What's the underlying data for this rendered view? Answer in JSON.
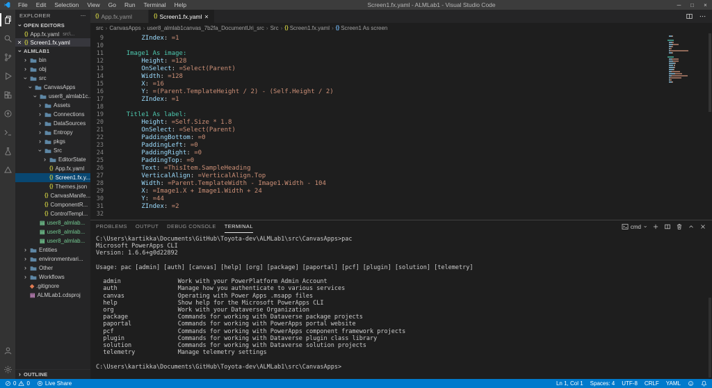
{
  "window": {
    "title": "Screen1.fx.yaml - ALMLab1 - Visual Studio Code",
    "menus": [
      "File",
      "Edit",
      "Selection",
      "View",
      "Go",
      "Run",
      "Terminal",
      "Help"
    ]
  },
  "activity_bar": {
    "top": [
      {
        "name": "explorer",
        "active": true
      },
      {
        "name": "search"
      },
      {
        "name": "source-control"
      },
      {
        "name": "run-debug"
      },
      {
        "name": "extensions"
      },
      {
        "name": "live-share"
      },
      {
        "name": "remote-explorer"
      },
      {
        "name": "test"
      },
      {
        "name": "power-platform"
      }
    ],
    "bottom": [
      {
        "name": "account"
      },
      {
        "name": "settings"
      }
    ]
  },
  "sidebar": {
    "title": "EXPLORER",
    "sections": {
      "open_editors": "OPEN EDITORS",
      "root": "ALMLAB1",
      "outline": "OUTLINE"
    },
    "open_editors": [
      {
        "label": "App.fx.yaml",
        "detail": "src\\...",
        "icon": "yaml",
        "active": false
      },
      {
        "label": "Screen1.fx.yaml",
        "icon": "yaml",
        "active": true
      }
    ],
    "tree": [
      {
        "label": "bin",
        "level": 1,
        "kind": "folder"
      },
      {
        "label": "obj",
        "level": 1,
        "kind": "folder"
      },
      {
        "label": "src",
        "level": 1,
        "kind": "folder",
        "expanded": true
      },
      {
        "label": "CanvasApps",
        "level": 2,
        "kind": "folder",
        "expanded": true
      },
      {
        "label": "user8_almlab1c...",
        "level": 3,
        "kind": "folder",
        "expanded": true
      },
      {
        "label": "Assets",
        "level": 4,
        "kind": "folder"
      },
      {
        "label": "Connections",
        "level": 4,
        "kind": "folder"
      },
      {
        "label": "DataSources",
        "level": 4,
        "kind": "folder"
      },
      {
        "label": "Entropy",
        "level": 4,
        "kind": "folder"
      },
      {
        "label": "pkgs",
        "level": 4,
        "kind": "folder"
      },
      {
        "label": "Src",
        "level": 4,
        "kind": "folder",
        "expanded": true
      },
      {
        "label": "EditorState",
        "level": 5,
        "kind": "folder"
      },
      {
        "label": "App.fx.yaml",
        "level": 5,
        "kind": "yaml"
      },
      {
        "label": "Screen1.fx.y...",
        "level": 5,
        "kind": "yaml",
        "selected": true
      },
      {
        "label": "Themes.json",
        "level": 5,
        "kind": "yaml"
      },
      {
        "label": "CanvasManife...",
        "level": 4,
        "kind": "yaml"
      },
      {
        "label": "ComponentR...",
        "level": 4,
        "kind": "yaml"
      },
      {
        "label": "ControlTempl...",
        "level": 4,
        "kind": "yaml"
      },
      {
        "label": "user8_almlab...",
        "level": 3,
        "kind": "file",
        "git": true
      },
      {
        "label": "user8_almlab...",
        "level": 3,
        "kind": "file",
        "git": true
      },
      {
        "label": "user8_almlab...",
        "level": 3,
        "kind": "file",
        "git": true
      },
      {
        "label": "Entities",
        "level": 1,
        "kind": "folder"
      },
      {
        "label": "environmentvari...",
        "level": 1,
        "kind": "folder"
      },
      {
        "label": "Other",
        "level": 1,
        "kind": "folder"
      },
      {
        "label": "Workflows",
        "level": 1,
        "kind": "folder"
      },
      {
        "label": ".gitignore",
        "level": 1,
        "kind": "git"
      },
      {
        "label": "ALMLab1.cdsproj",
        "level": 1,
        "kind": "proj"
      }
    ]
  },
  "editor": {
    "tabs": [
      {
        "label": "App.fx.yaml",
        "active": false
      },
      {
        "label": "Screen1.fx.yaml",
        "active": true
      }
    ],
    "breadcrumbs": [
      {
        "label": "src"
      },
      {
        "label": "CanvasApps"
      },
      {
        "label": "user8_almlab1canvas_7b2fa_DocumentUri_src"
      },
      {
        "label": "Src"
      },
      {
        "label": "Screen1.fx.yaml",
        "icon": "file"
      },
      {
        "label": "Screen1 As screen",
        "icon": "symbol"
      }
    ],
    "lines": [
      {
        "n": 9,
        "i": 8,
        "t": [
          [
            "ZIndex",
            "k"
          ],
          [
            ": ",
            "p"
          ],
          [
            "=1",
            "v"
          ]
        ]
      },
      {
        "n": 10,
        "i": 0,
        "t": []
      },
      {
        "n": 11,
        "i": 4,
        "t": [
          [
            "Image1 As image:",
            "d"
          ]
        ]
      },
      {
        "n": 12,
        "i": 8,
        "t": [
          [
            "Height",
            "k"
          ],
          [
            ": ",
            "p"
          ],
          [
            "=128",
            "v"
          ]
        ]
      },
      {
        "n": 13,
        "i": 8,
        "t": [
          [
            "OnSelect",
            "k"
          ],
          [
            ": ",
            "p"
          ],
          [
            "=Select(Parent)",
            "v"
          ]
        ]
      },
      {
        "n": 14,
        "i": 8,
        "t": [
          [
            "Width",
            "k"
          ],
          [
            ": ",
            "p"
          ],
          [
            "=128",
            "v"
          ]
        ]
      },
      {
        "n": 15,
        "i": 8,
        "t": [
          [
            "X",
            "k"
          ],
          [
            ": ",
            "p"
          ],
          [
            "=16",
            "v"
          ]
        ]
      },
      {
        "n": 16,
        "i": 8,
        "t": [
          [
            "Y",
            "k"
          ],
          [
            ": ",
            "p"
          ],
          [
            "=(Parent.TemplateHeight / 2) - (Self.Height / 2)",
            "v"
          ]
        ]
      },
      {
        "n": 17,
        "i": 8,
        "t": [
          [
            "ZIndex",
            "k"
          ],
          [
            ": ",
            "p"
          ],
          [
            "=1",
            "v"
          ]
        ]
      },
      {
        "n": 18,
        "i": 0,
        "t": []
      },
      {
        "n": 19,
        "i": 4,
        "t": [
          [
            "Title1 As label:",
            "d"
          ]
        ]
      },
      {
        "n": 20,
        "i": 8,
        "t": [
          [
            "Height",
            "k"
          ],
          [
            ": ",
            "p"
          ],
          [
            "=Self.Size * 1.8",
            "v"
          ]
        ]
      },
      {
        "n": 21,
        "i": 8,
        "t": [
          [
            "OnSelect",
            "k"
          ],
          [
            ": ",
            "p"
          ],
          [
            "=Select(Parent)",
            "v"
          ]
        ]
      },
      {
        "n": 22,
        "i": 8,
        "t": [
          [
            "PaddingBottom",
            "k"
          ],
          [
            ": ",
            "p"
          ],
          [
            "=0",
            "v"
          ]
        ]
      },
      {
        "n": 23,
        "i": 8,
        "t": [
          [
            "PaddingLeft",
            "k"
          ],
          [
            ": ",
            "p"
          ],
          [
            "=0",
            "v"
          ]
        ]
      },
      {
        "n": 24,
        "i": 8,
        "t": [
          [
            "PaddingRight",
            "k"
          ],
          [
            ": ",
            "p"
          ],
          [
            "=0",
            "v"
          ]
        ]
      },
      {
        "n": 25,
        "i": 8,
        "t": [
          [
            "PaddingTop",
            "k"
          ],
          [
            ": ",
            "p"
          ],
          [
            "=0",
            "v"
          ]
        ]
      },
      {
        "n": 26,
        "i": 8,
        "t": [
          [
            "Text",
            "k"
          ],
          [
            ": ",
            "p"
          ],
          [
            "=ThisItem.SampleHeading",
            "v"
          ]
        ]
      },
      {
        "n": 27,
        "i": 8,
        "t": [
          [
            "VerticalAlign",
            "k"
          ],
          [
            ": ",
            "p"
          ],
          [
            "=VerticalAlign.Top",
            "v"
          ]
        ]
      },
      {
        "n": 28,
        "i": 8,
        "t": [
          [
            "Width",
            "k"
          ],
          [
            ": ",
            "p"
          ],
          [
            "=Parent.TemplateWidth - Image1.Width - 104",
            "v"
          ]
        ]
      },
      {
        "n": 29,
        "i": 8,
        "t": [
          [
            "X",
            "k"
          ],
          [
            ": ",
            "p"
          ],
          [
            "=Image1.X + Image1.Width + 24",
            "v"
          ]
        ]
      },
      {
        "n": 30,
        "i": 8,
        "t": [
          [
            "Y",
            "k"
          ],
          [
            ": ",
            "p"
          ],
          [
            "=44",
            "v"
          ]
        ]
      },
      {
        "n": 31,
        "i": 8,
        "t": [
          [
            "ZIndex",
            "k"
          ],
          [
            ": ",
            "p"
          ],
          [
            "=2",
            "v"
          ]
        ]
      },
      {
        "n": 32,
        "i": 0,
        "t": []
      }
    ]
  },
  "panel": {
    "tabs": [
      {
        "label": "PROBLEMS"
      },
      {
        "label": "OUTPUT"
      },
      {
        "label": "DEBUG CONSOLE"
      },
      {
        "label": "TERMINAL",
        "active": true
      }
    ],
    "shell": "cmd",
    "terminal": [
      "C:\\Users\\kartikka\\Documents\\GitHub\\Toyota-dev\\ALMLab1\\src\\CanvasApps>pac",
      "Microsoft PowerApps CLI",
      "Version: 1.6.6+g0d22892",
      "",
      "Usage: pac [admin] [auth] [canvas] [help] [org] [package] [paportal] [pcf] [plugin] [solution] [telemetry]",
      "",
      "  admin                Work with your PowerPlatform Admin Account",
      "  auth                 Manage how you authenticate to various services",
      "  canvas               Operating with Power Apps .msapp files",
      "  help                 Show help for the Microsoft PowerApps CLI",
      "  org                  Work with your Dataverse Organization",
      "  package              Commands for working with Dataverse package projects",
      "  paportal             Commands for working with PowerApps portal website",
      "  pcf                  Commands for working with PowerApps component framework projects",
      "  plugin               Commands for working with Dataverse plugin class library",
      "  solution             Commands for working with Dataverse solution projects",
      "  telemetry            Manage telemetry settings",
      "",
      "C:\\Users\\kartikka\\Documents\\GitHub\\Toyota-dev\\ALMLab1\\src\\CanvasApps>"
    ]
  },
  "status_bar": {
    "errors": "0",
    "warnings": "0",
    "live_share": "Live Share",
    "right": [
      "Ln 1, Col 1",
      "Spaces: 4",
      "UTF-8",
      "CRLF",
      "YAML"
    ]
  },
  "colors": {
    "accent": "#007acc",
    "editor_bg": "#1e1e1e",
    "sidebar_bg": "#252526",
    "activity_bg": "#333333",
    "titlebar_bg": "#3c3c3c",
    "yaml_key": "#9cdcfe",
    "yaml_value": "#ce9178",
    "yaml_decl": "#4ec9b0",
    "git_untracked": "#73c991",
    "selection_bg": "#094771"
  }
}
